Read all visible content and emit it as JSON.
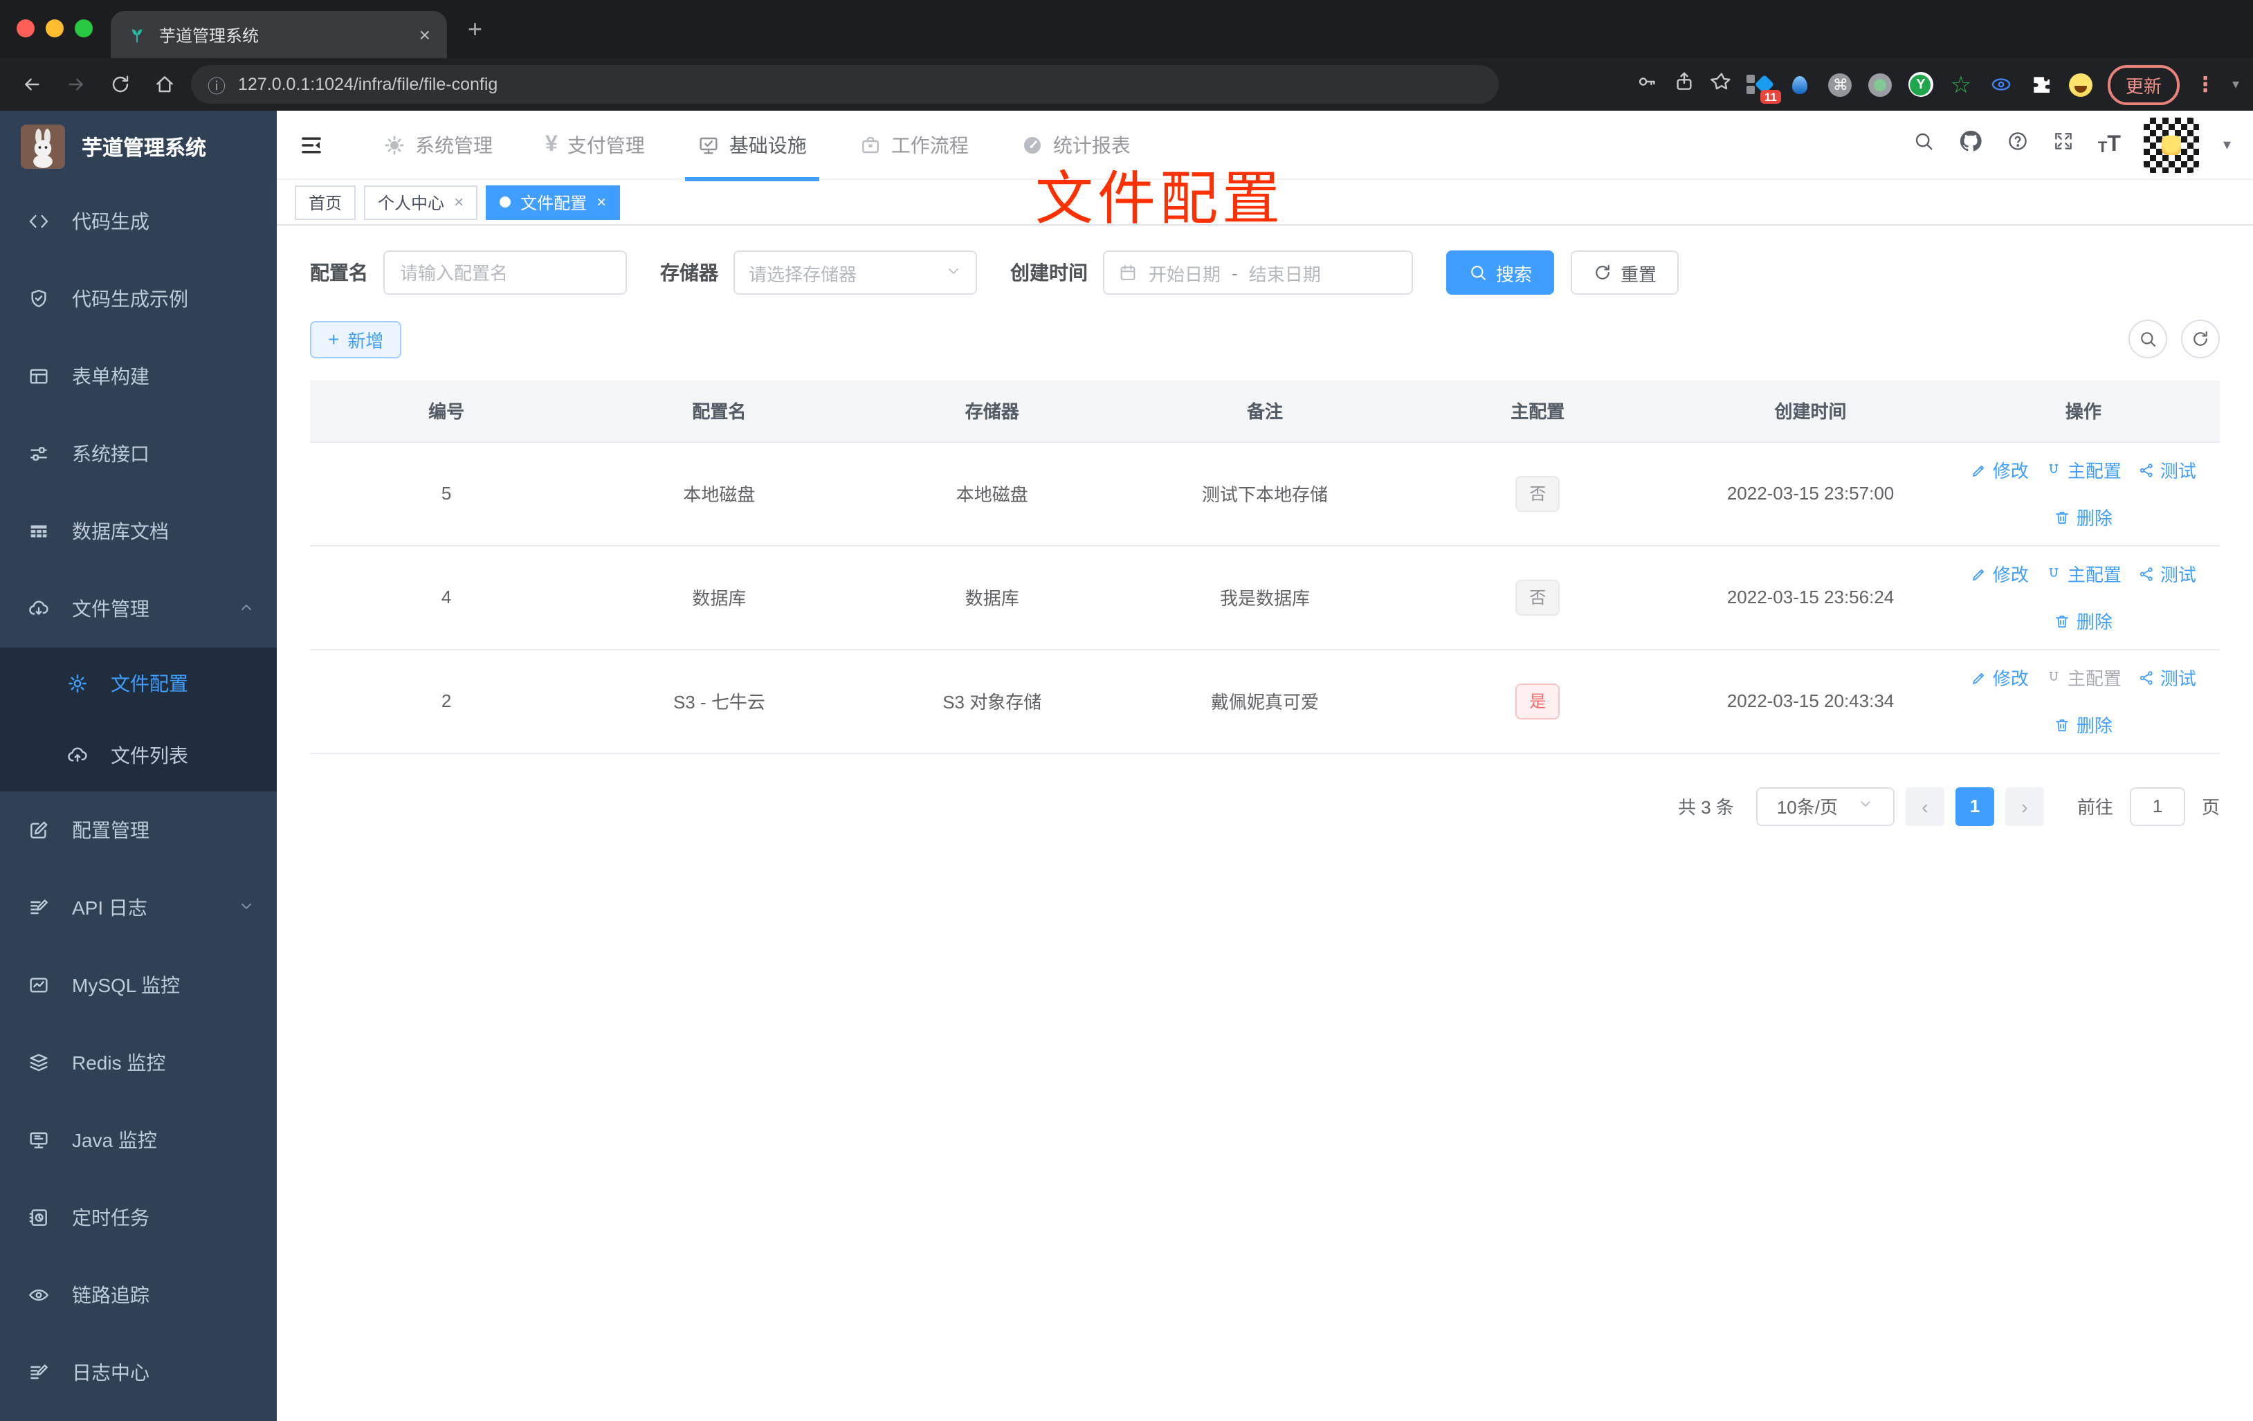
{
  "browser": {
    "tab_title": "芋道管理系统",
    "url": "127.0.0.1:1024/infra/file/file-config",
    "update_label": "更新",
    "ext_badge": "11"
  },
  "icons": {
    "plus": "+",
    "close": "×",
    "yen": "¥",
    "cmd": "⌘",
    "star_outline": "☆",
    "info": "ⓘ",
    "caret_down": "▾",
    "dot_menu": "⋮",
    "prev": "‹",
    "next": "›",
    "font_small": "T",
    "font_large": "T",
    "y_letter": "Y",
    "date_sep": "-"
  },
  "sidebar": {
    "title": "芋道管理系统",
    "menu": {
      "code_gen": "代码生成",
      "code_demo": "代码生成示例",
      "form_build": "表单构建",
      "sys_api": "系统接口",
      "db_doc": "数据库文档",
      "file_mgmt": "文件管理",
      "file_config": "文件配置",
      "file_list": "文件列表",
      "config_mgmt": "配置管理",
      "api_log": "API 日志",
      "mysql": "MySQL 监控",
      "redis": "Redis 监控",
      "java": "Java 监控",
      "job": "定时任务",
      "trace": "链路追踪",
      "log_center": "日志中心"
    }
  },
  "topnav": {
    "system": "系统管理",
    "pay": "支付管理",
    "infra": "基础设施",
    "workflow": "工作流程",
    "report": "统计报表"
  },
  "tags": {
    "home": "首页",
    "profile": "个人中心",
    "current": "文件配置"
  },
  "annotation": {
    "text": "文件配置"
  },
  "filters": {
    "name_label": "配置名",
    "name_placeholder": "请输入配置名",
    "storage_label": "存储器",
    "storage_placeholder": "请选择存储器",
    "time_label": "创建时间",
    "start_placeholder": "开始日期",
    "end_placeholder": "结束日期",
    "search_label": "搜索",
    "reset_label": "重置"
  },
  "toolbar": {
    "add_label": "新增"
  },
  "table": {
    "headers": [
      "编号",
      "配置名",
      "存储器",
      "备注",
      "主配置",
      "创建时间",
      "操作"
    ],
    "action_labels": {
      "edit": "修改",
      "master": "主配置",
      "test": "测试",
      "delete": "删除"
    },
    "rows": [
      {
        "id": "5",
        "name": "本地磁盘",
        "storage": "本地磁盘",
        "remark": "测试下本地存储",
        "master": "否",
        "time": "2022-03-15 23:57:00"
      },
      {
        "id": "4",
        "name": "数据库",
        "storage": "数据库",
        "remark": "我是数据库",
        "master": "否",
        "time": "2022-03-15 23:56:24"
      },
      {
        "id": "2",
        "name": "S3 - 七牛云",
        "storage": "S3 对象存储",
        "remark": "戴佩妮真可爱",
        "master": "是",
        "time": "2022-03-15 20:43:34"
      }
    ]
  },
  "pagination": {
    "total": "共 3 条",
    "page_size": "10条/页",
    "current_page": "1",
    "goto_label": "前往",
    "goto_value": "1",
    "page_unit": "页"
  }
}
